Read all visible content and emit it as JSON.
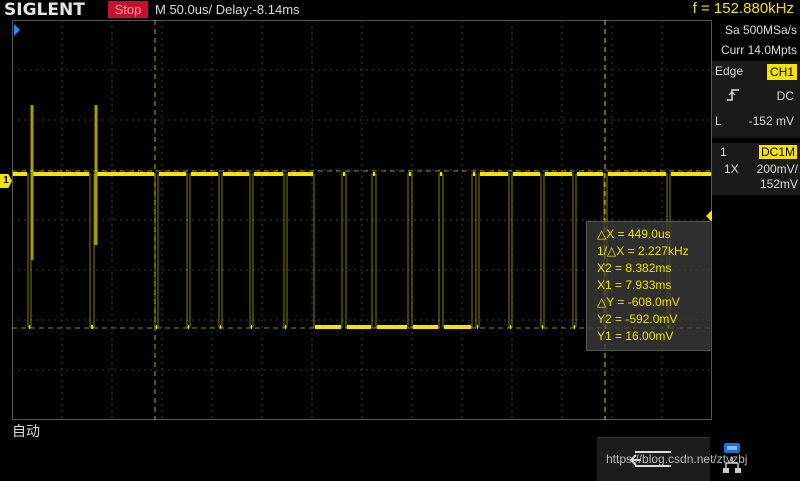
{
  "header": {
    "brand": "SIGLENT",
    "run_state": "Stop",
    "timebase": "M 50.0us/",
    "delay": "Delay:-8.14ms",
    "frequency": "f = 152.880kHz"
  },
  "acquisition": {
    "sample_rate": "Sa 500MSa/s",
    "memory_depth": "Curr 14.0Mpts"
  },
  "trigger": {
    "type": "Edge",
    "source": "CH1",
    "slope_icon": "rising-edge-icon",
    "coupling": "DC",
    "level_label": "L",
    "level": "-152 mV"
  },
  "channel1": {
    "number": "1",
    "coupling": "DC1M",
    "probe": "1X",
    "scale": "200mV/",
    "offset": "152mV"
  },
  "cursors": {
    "delta_x": "△X = 449.0us",
    "inv_delta_x": "1/△X = 2.227kHz",
    "x2": "X2 = 8.382ms",
    "x1": "X1 = 7.933ms",
    "delta_y": "△Y = -608.0mV",
    "y2": "Y2 = -592.0mV",
    "y1": "Y1 = 16.00mV"
  },
  "markers": {
    "trigger_pos": "◀",
    "channel_level": "1"
  },
  "bottom": {
    "mode": "自动",
    "back_icon": "return-arrow-icon",
    "network_icon": "network-icon",
    "watermark": "https://blog.csdn.net/ztvzbj"
  },
  "colors": {
    "trace": "#f4e200",
    "background": "#000000",
    "grid": "#444444",
    "run_state_bg": "#c8102e"
  }
}
